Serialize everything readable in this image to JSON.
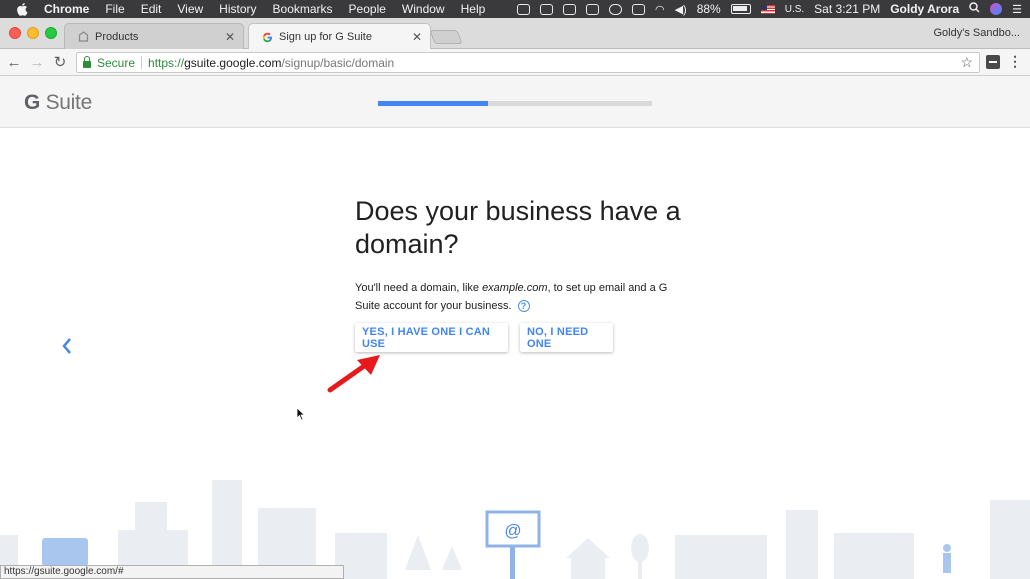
{
  "menubar": {
    "app_name": "Chrome",
    "items": [
      "File",
      "Edit",
      "View",
      "History",
      "Bookmarks",
      "People",
      "Window",
      "Help"
    ],
    "battery": "88%",
    "input_source": "U.S.",
    "clock": "Sat 3:21 PM",
    "user": "Goldy Arora"
  },
  "tabs": [
    {
      "title": "Products",
      "active": false
    },
    {
      "title": "Sign up for G Suite",
      "active": true
    }
  ],
  "profile_name": "Goldy's Sandbo...",
  "omnibox": {
    "secure_label": "Secure",
    "url_proto": "https://",
    "url_host": "gsuite.google.com",
    "url_path": "/signup/basic/domain"
  },
  "header": {
    "logo_g": "G",
    "logo_text": " Suite",
    "progress": 0.4
  },
  "main": {
    "heading": "Does your business have a domain?",
    "desc_before": "You'll need a domain, like ",
    "desc_example": "example.com",
    "desc_after": ", to set up email and a G Suite account for your business.",
    "help_glyph": "?",
    "yes_button": "YES, I HAVE ONE I CAN USE",
    "no_button": "NO, I NEED ONE"
  },
  "billboard_symbol": "@",
  "status_url": "https://gsuite.google.com/#",
  "colors": {
    "accent": "#4285f4",
    "annotation_arrow": "#e8191c",
    "skyline": "#e9ebee"
  }
}
